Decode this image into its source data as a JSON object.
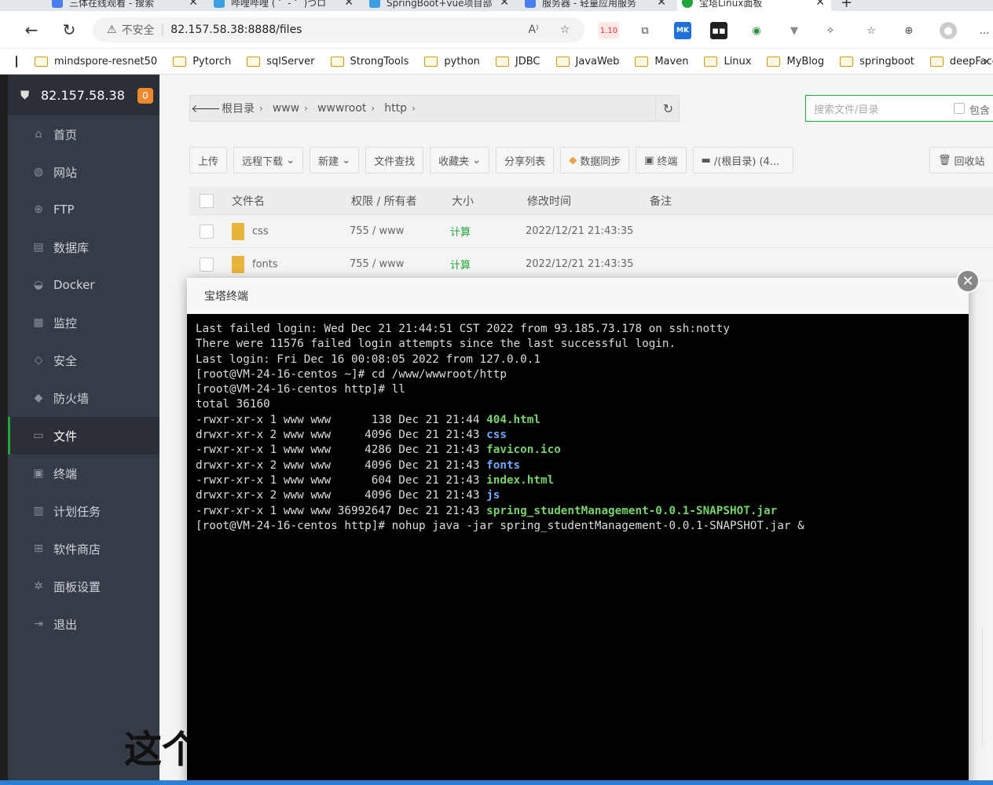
{
  "browser": {
    "tabs": [
      {
        "label": "三体在线观看 - 搜索",
        "color": "#4a7df0"
      },
      {
        "label": "哔哩哔哩 ( ゜- ゜)つロ",
        "color": "#3aa0e0"
      },
      {
        "label": "SpringBoot+vue项目部",
        "color": "#3aa0e0"
      },
      {
        "label": "服务器 - 轻量应用服务",
        "color": "#4a7df0"
      },
      {
        "label": "宝塔Linux面板",
        "color": "#20a53a"
      }
    ],
    "new_tab": "+",
    "address": {
      "insecure_label": "不安全",
      "separator": "|",
      "url": "82.157.58.38:8888/files"
    },
    "extension_badge": "1.10",
    "bookmarks": [
      "mindspore-resnet50",
      "Pytorch",
      "sqlServer",
      "StrongTools",
      "python",
      "JDBC",
      "JavaWeb",
      "Maven",
      "Linux",
      "MyBlog",
      "springboot",
      "deepFace"
    ]
  },
  "sidebar": {
    "server_ip": "82.157.58.38",
    "badge": "0",
    "items": [
      {
        "label": "首页",
        "icon": "home-icon",
        "glyph": "⌂"
      },
      {
        "label": "网站",
        "icon": "globe-icon",
        "glyph": "◍"
      },
      {
        "label": "FTP",
        "icon": "ftp-icon",
        "glyph": "⊕"
      },
      {
        "label": "数据库",
        "icon": "database-icon",
        "glyph": "▤"
      },
      {
        "label": "Docker",
        "icon": "docker-icon",
        "glyph": "◒"
      },
      {
        "label": "监控",
        "icon": "monitor-icon",
        "glyph": "▦"
      },
      {
        "label": "安全",
        "icon": "shield-check-icon",
        "glyph": "◇"
      },
      {
        "label": "防火墙",
        "icon": "firewall-icon",
        "glyph": "◆"
      },
      {
        "label": "文件",
        "icon": "folder-icon",
        "glyph": "▭",
        "active": true
      },
      {
        "label": "终端",
        "icon": "terminal-icon",
        "glyph": "▣"
      },
      {
        "label": "计划任务",
        "icon": "calendar-icon",
        "glyph": "▥"
      },
      {
        "label": "软件商店",
        "icon": "apps-icon",
        "glyph": "⊞"
      },
      {
        "label": "面板设置",
        "icon": "settings-icon",
        "glyph": "✲"
      },
      {
        "label": "退出",
        "icon": "logout-icon",
        "glyph": "⇥"
      }
    ]
  },
  "files": {
    "breadcrumb": [
      "根目录",
      "www",
      "wwwroot",
      "http"
    ],
    "search_placeholder": "搜索文件/目录",
    "search_include": "包含",
    "toolbar": {
      "upload": "上传",
      "remote_download": "远程下载",
      "new": "新建",
      "find": "文件查找",
      "favorites": "收藏夹",
      "share_list": "分享列表",
      "data_sync": "数据同步",
      "terminal": "终端",
      "disk": "/(根目录) (4...",
      "recycle": "回收站"
    },
    "columns": {
      "name": "文件名",
      "perm": "权限 / 所有者",
      "size": "大小",
      "mtime": "修改时间",
      "note": "备注"
    },
    "rows": [
      {
        "name": "css",
        "perm": "755 / www",
        "size": "计算",
        "mtime": "2022/12/21 21:43:35"
      },
      {
        "name": "fonts",
        "perm": "755 / www",
        "size": "计算",
        "mtime": "2022/12/21 21:43:35"
      }
    ]
  },
  "terminal": {
    "title": "宝塔终端",
    "lines": [
      {
        "text": "Last failed login: Wed Dec 21 21:44:51 CST 2022 from 93.185.73.178 on ssh:notty"
      },
      {
        "text": "There were 11576 failed login attempts since the last successful login."
      },
      {
        "text": "Last login: Fri Dec 16 00:08:05 2022 from 127.0.0.1"
      },
      {
        "text": "[root@VM-24-16-centos ~]# cd /www/wwwroot/http"
      },
      {
        "text": "[root@VM-24-16-centos http]# ll"
      },
      {
        "text": "total 36160"
      },
      {
        "prefix": "-rwxr-xr-x 1 www www      138 Dec 21 21:44 ",
        "name": "404.html",
        "color": "g"
      },
      {
        "prefix": "drwxr-xr-x 2 www www     4096 Dec 21 21:43 ",
        "name": "css",
        "color": "b"
      },
      {
        "prefix": "-rwxr-xr-x 1 www www     4286 Dec 21 21:43 ",
        "name": "favicon.ico",
        "color": "g"
      },
      {
        "prefix": "drwxr-xr-x 2 www www     4096 Dec 21 21:43 ",
        "name": "fonts",
        "color": "b"
      },
      {
        "prefix": "-rwxr-xr-x 1 www www      604 Dec 21 21:43 ",
        "name": "index.html",
        "color": "g"
      },
      {
        "prefix": "drwxr-xr-x 2 www www     4096 Dec 21 21:43 ",
        "name": "js",
        "color": "b"
      },
      {
        "prefix": "-rwxr-xr-x 1 www www 36992647 Dec 21 21:43 ",
        "name": "spring_studentManagement-0.0.1-SNAPSHOT.jar",
        "color": "g"
      },
      {
        "text": "[root@VM-24-16-centos http]# nohup java -jar spring_studentManagement-0.0.1-SNAPSHOT.jar &"
      }
    ]
  },
  "caption": "这个"
}
